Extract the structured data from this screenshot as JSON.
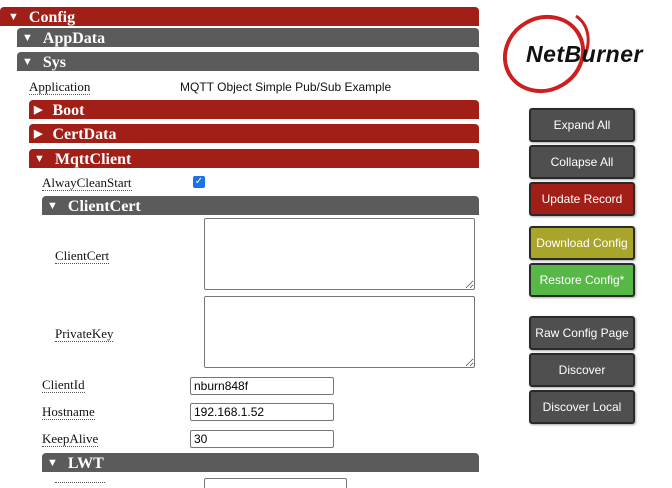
{
  "tree": {
    "config": "Config",
    "appdata": "AppData",
    "sys": "Sys",
    "application_label": "Application",
    "application_value": "MQTT Object Simple Pub/Sub Example",
    "boot": "Boot",
    "certdata": "CertData",
    "mqttclient": "MqttClient",
    "alwaycleanstart_label": "AlwayCleanStart",
    "alwaycleanstart_checked": true,
    "clientcert_section": "ClientCert",
    "clientcert_label": "ClientCert",
    "privatekey_label": "PrivateKey",
    "clientid_label": "ClientId",
    "clientid_value": "nburn848f",
    "hostname_label": "Hostname",
    "hostname_value": "192.168.1.52",
    "keepalive_label": "KeepAlive",
    "keepalive_value": "30",
    "lwt_section": "LWT"
  },
  "logo": {
    "text": "NetBurner",
    "color": "#cc1f1f"
  },
  "buttons": {
    "expand_all": "Expand All",
    "collapse_all": "Collapse All",
    "update_record": "Update Record",
    "download_config": "Download Config",
    "restore_config": "Restore Config*",
    "raw_config_page": "Raw Config Page",
    "discover": "Discover",
    "discover_local": "Discover Local"
  },
  "colors": {
    "section_red": "#a11f17",
    "section_grey": "#5b5b5b",
    "btn_grey": "#4f4f4f",
    "btn_red": "#a11f17",
    "btn_yellow": "#a8a52a",
    "btn_green": "#58b847"
  },
  "icons": {
    "expanded": "triangle-down-icon",
    "collapsed": "triangle-right-icon"
  }
}
